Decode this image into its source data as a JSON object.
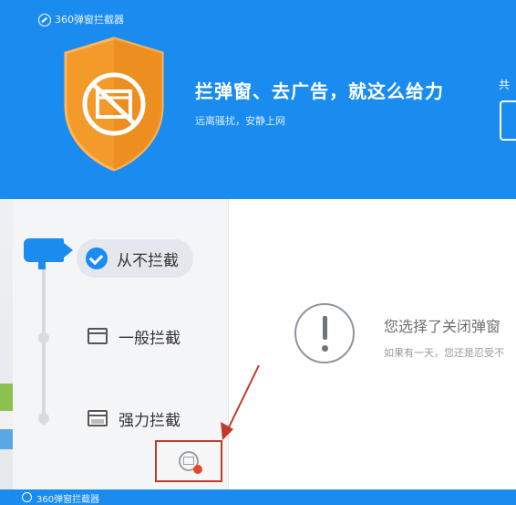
{
  "window": {
    "app_title": "360弹窗拦截器"
  },
  "header": {
    "slogan": "拦弹窗、去广告，就这么给力",
    "subslogan": "远离骚扰，安静上网",
    "right_label": "共"
  },
  "sidebar": {
    "options": [
      {
        "label": "从不拦截",
        "selected": true,
        "icon": "check-circle-icon"
      },
      {
        "label": "一般拦截",
        "selected": false,
        "icon": "window-icon"
      },
      {
        "label": "强力拦截",
        "selected": false,
        "icon": "window-strong-icon"
      }
    ]
  },
  "main": {
    "message": "您选择了关闭弹窗",
    "sub_message": "如果有一天，您还是忍受不"
  },
  "bottom_bar": {
    "app_title": "360弹窗拦截器"
  },
  "colors": {
    "accent": "#1a8cf0",
    "shield": "#f39a2b",
    "annotation": "#c0392b"
  }
}
